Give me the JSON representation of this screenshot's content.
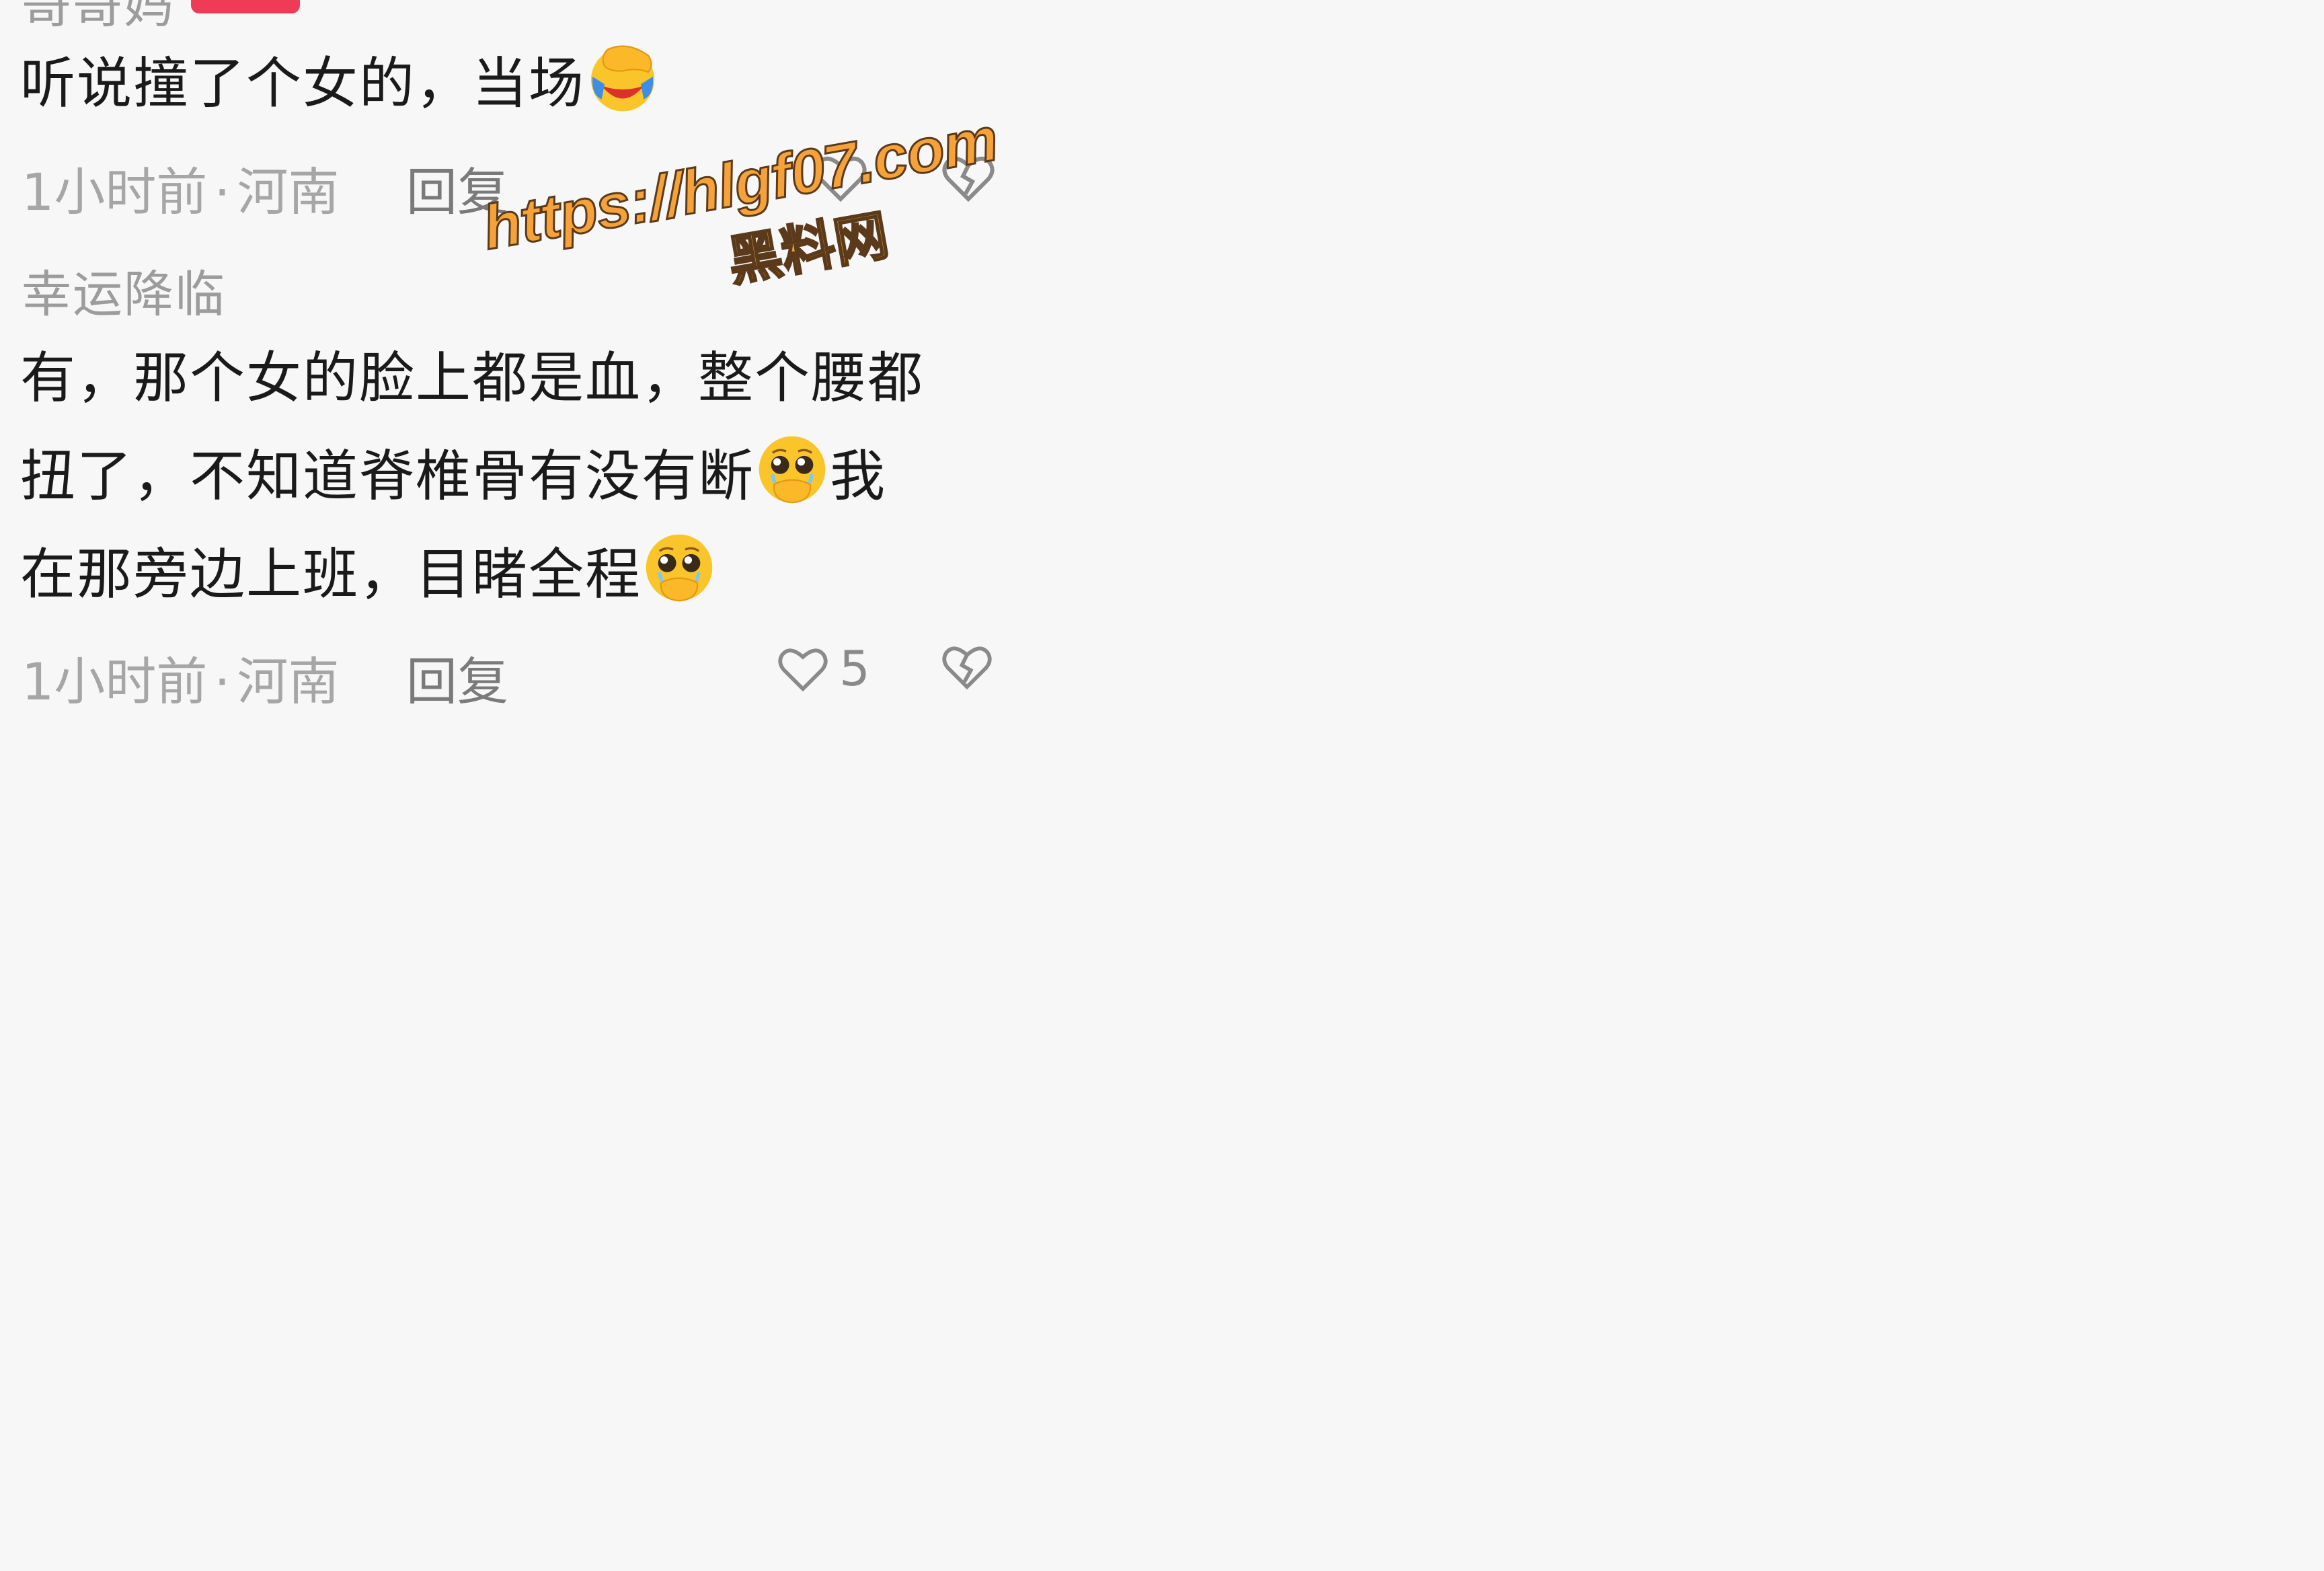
{
  "comment1": {
    "username": "哥哥妈",
    "text": "听说撞了个女的，当场",
    "emoji": "face-with-hand-over-eyes-crying-icon",
    "time": "1小时前",
    "separator": "·",
    "location": "河南",
    "reply_label": "回复"
  },
  "comment2": {
    "username": "幸运降临",
    "text_line1": "有，那个女的脸上都是血，整个腰都",
    "text_line2a": "扭了，不知道脊椎骨有没有断",
    "text_line2b": "我",
    "text_line3": "在那旁边上班，目睹全程",
    "emoji": "pleading-face-holding-back-tears-icon",
    "time": "1小时前",
    "separator": "·",
    "location": "河南",
    "reply_label": "回复",
    "like_count": "5"
  },
  "watermark": {
    "url": "https://hlgf07.com",
    "name": "黑料网"
  },
  "colors": {
    "badge": "#ef3b55",
    "watermark": "#f6a23a",
    "text": "#1a1a1a",
    "meta": "#a6a6a6"
  }
}
